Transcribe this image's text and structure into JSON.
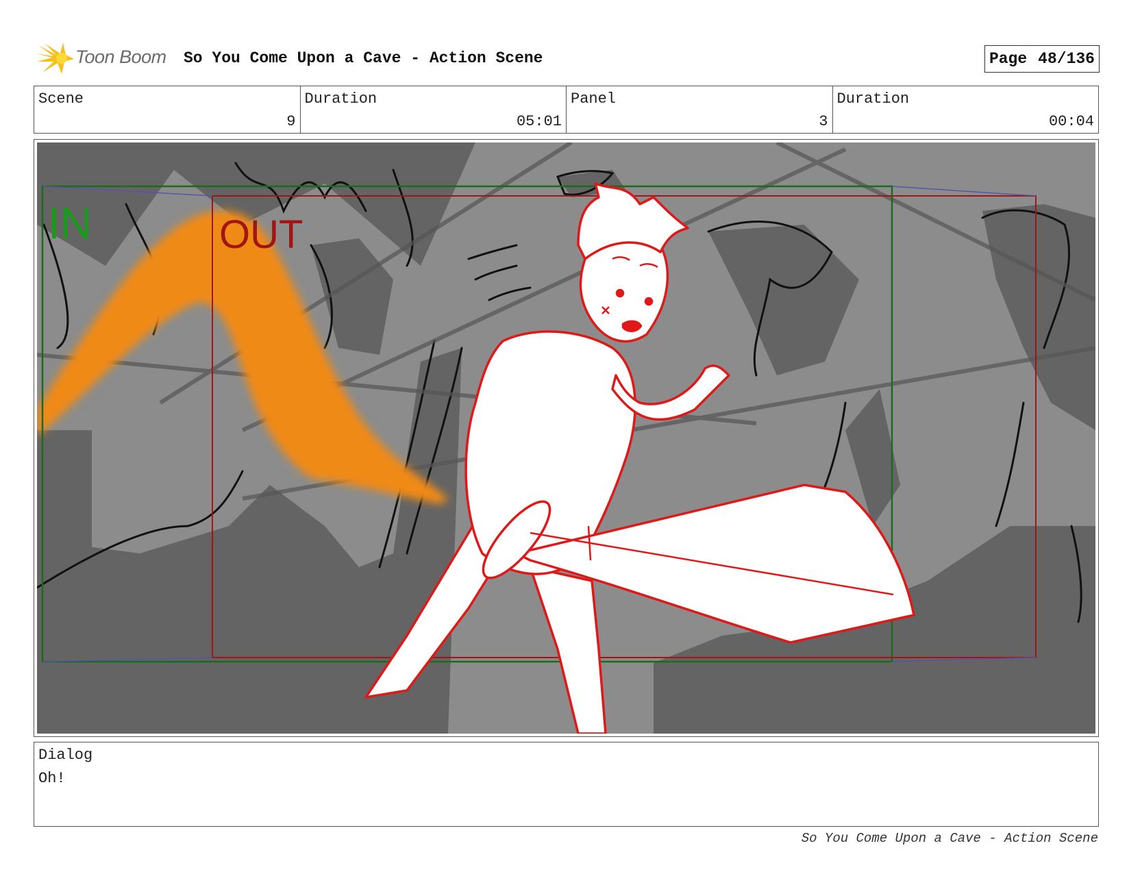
{
  "header": {
    "logo_text": "Toon Boom",
    "title": "So You Come Upon a Cave - Action Scene",
    "page_label": "Page",
    "page_value": "48/136"
  },
  "info": {
    "scene_label": "Scene",
    "scene_value": "9",
    "duration_label": "Duration",
    "duration_value": "05:01",
    "panel_label": "Panel",
    "panel_value": "3",
    "panel_duration_label": "Duration",
    "panel_duration_value": "00:04"
  },
  "panel": {
    "in_label": "IN",
    "out_label": "OUT",
    "colors": {
      "background": "#8c8c8c",
      "rock_dark": "#646464",
      "in_frame": "#1a6b1a",
      "out_frame": "#a31515",
      "character_line": "#e01818",
      "flame": "#f08a12"
    }
  },
  "dialog": {
    "label": "Dialog",
    "text": "Oh!"
  },
  "footer": {
    "text": "So You Come Upon a Cave - Action Scene"
  }
}
